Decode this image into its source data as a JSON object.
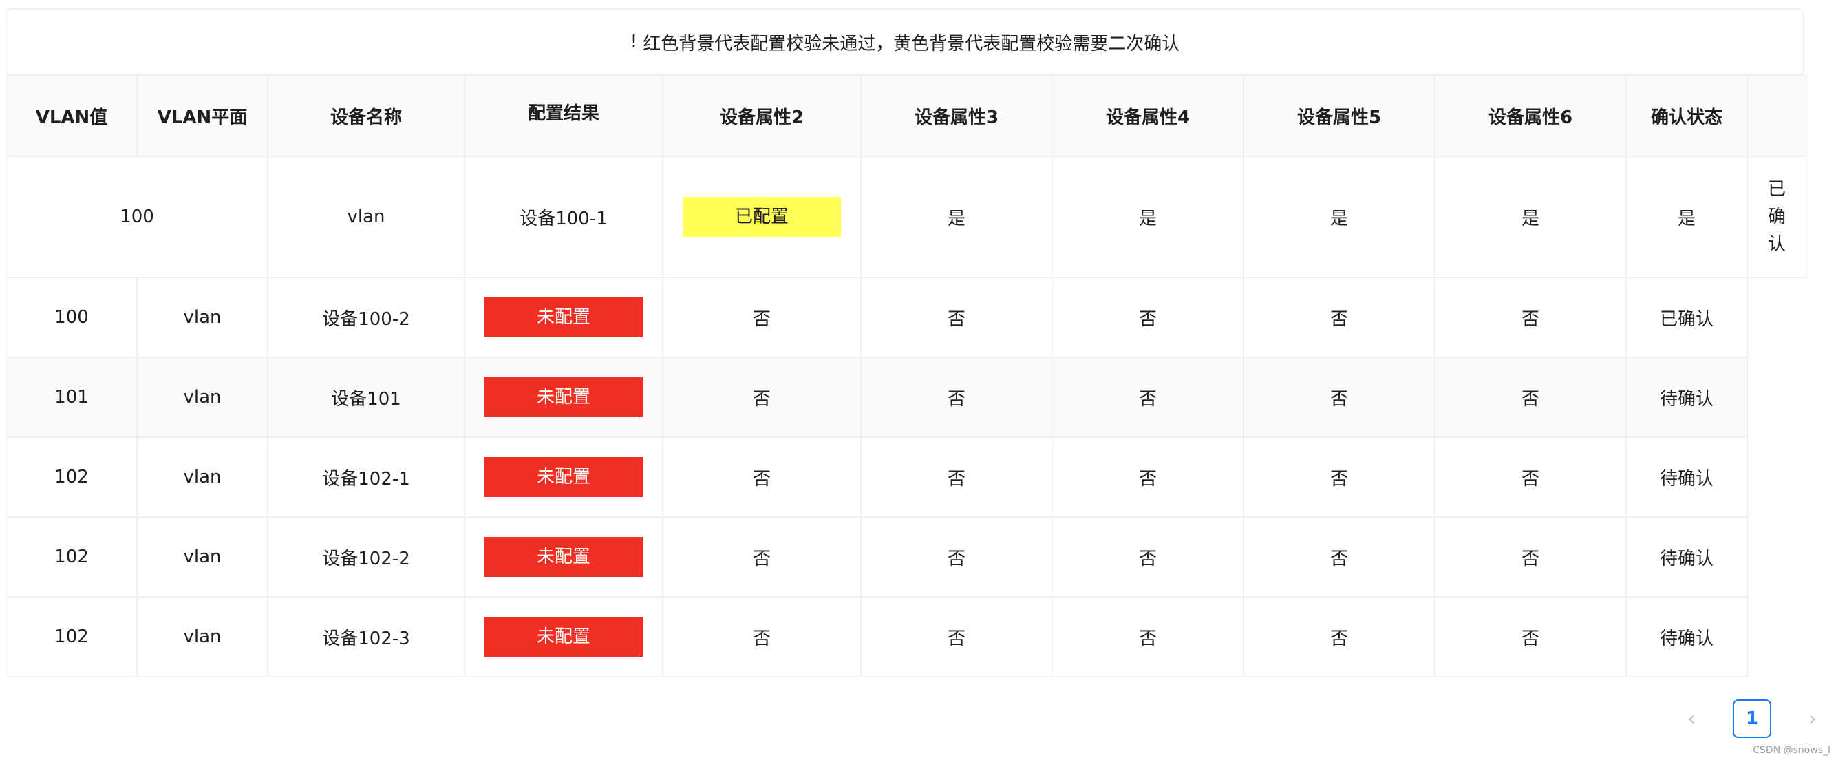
{
  "notice": {
    "icon": "!",
    "text": "红色背景代表配置校验未通过，黄色背景代表配置校验需要二次确认"
  },
  "columns": [
    "VLAN值",
    "VLAN平面",
    "设备名称",
    "配置结果",
    "设备属性2",
    "设备属性3",
    "设备属性4",
    "设备属性5",
    "设备属性6",
    "确认状态"
  ],
  "first_row": {
    "vlan": "100",
    "plane": "vlan",
    "device": "设备100-1",
    "result": "已配置",
    "attr2": "是",
    "attr3": "是",
    "attr4": "是",
    "attr5": "是",
    "attr6": "是",
    "status": "已确认"
  },
  "rows": [
    {
      "vlan": "100",
      "plane": "vlan",
      "device": "设备100-2",
      "result": "未配置",
      "attr2": "否",
      "attr3": "否",
      "attr4": "否",
      "attr5": "否",
      "attr6": "否",
      "status": "已确认"
    },
    {
      "vlan": "101",
      "plane": "vlan",
      "device": "设备101",
      "result": "未配置",
      "attr2": "否",
      "attr3": "否",
      "attr4": "否",
      "attr5": "否",
      "attr6": "否",
      "status": "待确认"
    },
    {
      "vlan": "102",
      "plane": "vlan",
      "device": "设备102-1",
      "result": "未配置",
      "attr2": "否",
      "attr3": "否",
      "attr4": "否",
      "attr5": "否",
      "attr6": "否",
      "status": "待确认"
    },
    {
      "vlan": "102",
      "plane": "vlan",
      "device": "设备102-2",
      "result": "未配置",
      "attr2": "否",
      "attr3": "否",
      "attr4": "否",
      "attr5": "否",
      "attr6": "否",
      "status": "待确认"
    },
    {
      "vlan": "102",
      "plane": "vlan",
      "device": "设备102-3",
      "result": "未配置",
      "attr2": "否",
      "attr3": "否",
      "attr4": "否",
      "attr5": "否",
      "attr6": "否",
      "status": "待确认"
    }
  ],
  "pagination": {
    "prev": "‹",
    "current": "1",
    "next": "›"
  },
  "watermark": "CSDN @snows_l",
  "colors": {
    "unconfigured": "#ee3024",
    "needs_confirm": "#ffff55",
    "accent": "#1677ff"
  }
}
